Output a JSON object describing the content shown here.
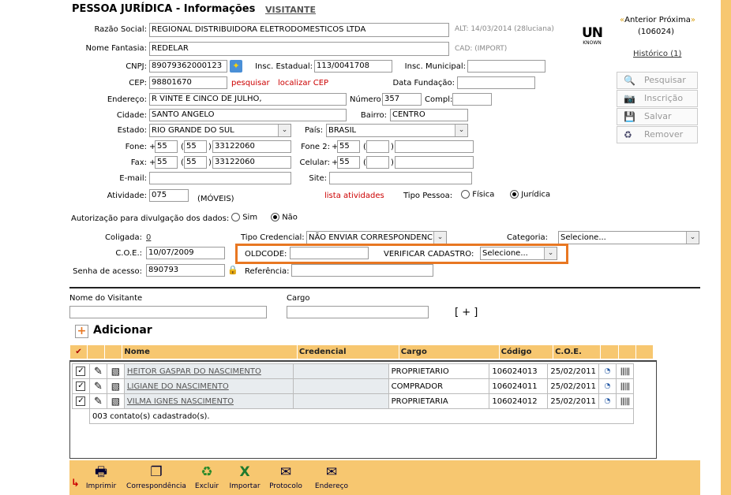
{
  "header": {
    "title": "PESSOA JURÍDICA - Informações",
    "visitor_link": "VISITANTE"
  },
  "nav": {
    "prev": "Anterior",
    "next": "Próxima",
    "id": "(106024)",
    "history": "Histórico (1)"
  },
  "logo": {
    "line1": "UN",
    "line2": "KNOWN"
  },
  "form": {
    "razao_label": "Razão Social:",
    "razao_value": "REGIONAL DISTRIBUIDORA ELETRODOMESTICOS LTDA",
    "alt_info": "ALT: 14/03/2014 (28luciana)",
    "fantasia_label": "Nome Fantasia:",
    "fantasia_value": "REDELAR",
    "cad_info": "CAD: (IMPORT)",
    "cnpj_label": "CNPJ:",
    "cnpj_value": "89079362000123",
    "ie_label": "Insc. Estadual:",
    "ie_value": "113/0041708",
    "im_label": "Insc. Municipal:",
    "im_value": "",
    "cep_label": "CEP:",
    "cep_value": "98801670",
    "cep_search": "pesquisar",
    "cep_locate": "localizar CEP",
    "fundacao_label": "Data Fundação:",
    "fundacao_value": "",
    "endereco_label": "Endereço:",
    "endereco_value": "R VINTE E CINCO DE JULHO,",
    "numero_label": "Número:",
    "numero_value": "357",
    "compl_label": "Compl:",
    "compl_value": "",
    "cidade_label": "Cidade:",
    "cidade_value": "SANTO ANGELO",
    "bairro_label": "Bairro:",
    "bairro_value": "CENTRO",
    "estado_label": "Estado:",
    "estado_value": "RIO GRANDE DO SUL",
    "pais_label": "País:",
    "pais_value": "BRASIL",
    "fone_label": "Fone:",
    "fone_ddi": "55",
    "fone_ddd": "55",
    "fone_num": "33122060",
    "fone2_label": "Fone 2:",
    "fone2_ddi": "55",
    "fone2_ddd": "",
    "fone2_num": "",
    "fax_label": "Fax:",
    "fax_ddi": "55",
    "fax_ddd": "55",
    "fax_num": "33122060",
    "celular_label": "Celular:",
    "cel_ddi": "55",
    "cel_ddd": "",
    "cel_num": "",
    "email_label": "E-mail:",
    "email_value": "",
    "site_label": "Site:",
    "site_value": "",
    "atividade_label": "Atividade:",
    "atividade_value": "075",
    "atividade_desc": "(MÓVEIS)",
    "lista_atividades": "lista atividades",
    "tipo_label": "Tipo Pessoa:",
    "tipo_fisica": "Física",
    "tipo_juridica": "Jurídica",
    "autorizacao_label": "Autorização para divulgação dos dados:",
    "sim": "Sim",
    "nao": "Não",
    "coligada_label": "Coligada:",
    "coligada_value": "0",
    "credencial_label": "Tipo Credencial:",
    "credencial_value": "NÃO ENVIAR CORRESPONDENC",
    "categoria_label": "Categoria:",
    "categoria_value": "Selecione...",
    "coe_label": "C.O.E.:",
    "coe_value": "10/07/2009",
    "oldcode_label": "OLDCODE:",
    "oldcode_value": "",
    "verificar_label": "VERIFICAR CADASTRO:",
    "verificar_value": "Selecione...",
    "senha_label": "Senha de acesso:",
    "senha_value": "890793",
    "referencia_label": "Referência:",
    "referencia_value": ""
  },
  "sidebuttons": {
    "pesquisar": "Pesquisar",
    "inscricao": "Inscrição",
    "salvar": "Salvar",
    "remover": "Remover"
  },
  "visitor": {
    "name_label": "Nome do Visitante",
    "cargo_label": "Cargo",
    "add_more": "[ + ]",
    "add_label": "Adicionar"
  },
  "grid": {
    "headers": [
      "Nome",
      "Credencial",
      "Cargo",
      "Código",
      "C.O.E."
    ],
    "rows": [
      {
        "nome": "HEITOR GASPAR DO NASCIMENTO",
        "credencial": "",
        "cargo": "PROPRIETARIO",
        "codigo": "106024013",
        "coe": "25/02/2011"
      },
      {
        "nome": "LIGIANE DO NASCIMENTO",
        "credencial": "",
        "cargo": "COMPRADOR",
        "codigo": "106024011",
        "coe": "25/02/2011"
      },
      {
        "nome": "VILMA IGNES NASCIMENTO",
        "credencial": "",
        "cargo": "PROPRIETARIA",
        "codigo": "106024012",
        "coe": "25/02/2011"
      }
    ],
    "count": "003 contato(s) cadastrado(s)."
  },
  "footer": {
    "imprimir": "Imprimir",
    "correspondencia": "Correspondência",
    "excluir": "Excluir",
    "importar": "Importar",
    "protocolo": "Protocolo",
    "endereco": "Endereço"
  },
  "colors": {
    "accent": "#f7c770",
    "highlight": "#e87722",
    "link_red": "#cc0000"
  }
}
